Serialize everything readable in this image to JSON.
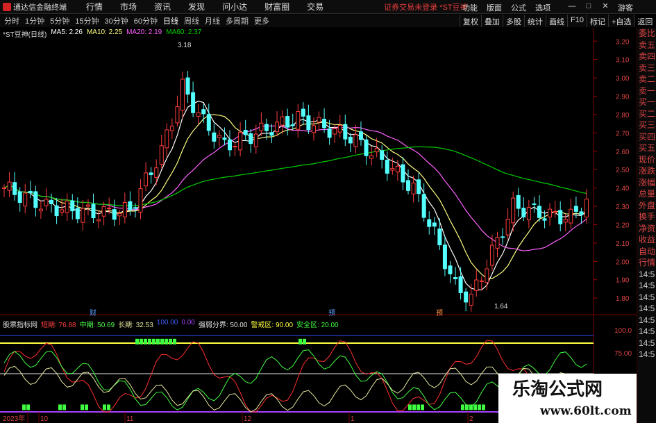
{
  "app": {
    "title": "通达信金融终端",
    "ticker_notice": "证券交易未登录  *ST豆神",
    "guest": "游客"
  },
  "menus": [
    "行情",
    "市场",
    "资讯",
    "发现",
    "问小达",
    "财富圈",
    "交易"
  ],
  "sys_menus": [
    "功能",
    "版面",
    "公式",
    "选项"
  ],
  "periods": [
    "分时",
    "1分钟",
    "5分钟",
    "15分钟",
    "30分钟",
    "60分钟",
    "日线",
    "周线",
    "月线",
    "多周期",
    "更多"
  ],
  "active_period": "日线",
  "right_buttons": [
    "复权",
    "叠加",
    "多股",
    "统计",
    "画线",
    "F10",
    "标记",
    "+自选",
    "返回"
  ],
  "right_panel": [
    "委比",
    "卖五",
    "卖四",
    "卖三",
    "卖二",
    "卖一",
    "买一",
    "买二",
    "买三",
    "买四",
    "买五",
    "现价",
    "涨跌",
    "涨幅",
    "总量",
    "外盘",
    "换手",
    "净资",
    "收益",
    "自动",
    "行情",
    "14:5",
    "14:5",
    "14:5",
    "14:5",
    "14:5",
    "14:5",
    "14:5",
    "14:5"
  ],
  "legend": {
    "title": "*ST豆神(日线)",
    "ma5": "MA5: 2.26",
    "ma10": "MA10: 2.25",
    "ma20": "MA20: 2.19",
    "ma60": "MA60: 2.37"
  },
  "indicator": {
    "name": "股票指标网",
    "short": "短期: 76.88",
    "mid": "中期: 50.69",
    "long": "长期: 32.53",
    "l100": "100.00",
    "l0": "0.00",
    "split": "强弱分界: 50.00",
    "warn": "警戒区: 90.00",
    "safe": "安全区: 20.00"
  },
  "price_axis": [
    "3.20",
    "3.10",
    "3.00",
    "2.90",
    "2.80",
    "2.70",
    "2.60",
    "2.50",
    "2.40",
    "2.30",
    "2.20",
    "2.10",
    "2.00",
    "1.90",
    "1.80"
  ],
  "ind_axis": [
    "100.0",
    "75.00"
  ],
  "annotations": {
    "high": "3.18",
    "low": "1.64"
  },
  "event_marks": [
    "财",
    "预",
    "预"
  ],
  "x_axis": [
    "2023年",
    "10",
    "11",
    "12",
    "1",
    "2"
  ],
  "colors": {
    "up": "#ff3c3c",
    "down": "#54ffff",
    "ma5": "#ffffff",
    "ma10": "#ffff80",
    "ma20": "#ff60ff",
    "ma60": "#00d000"
  },
  "watermark": {
    "title": "乐淘公式网",
    "url": "www.60lt.com"
  }
}
